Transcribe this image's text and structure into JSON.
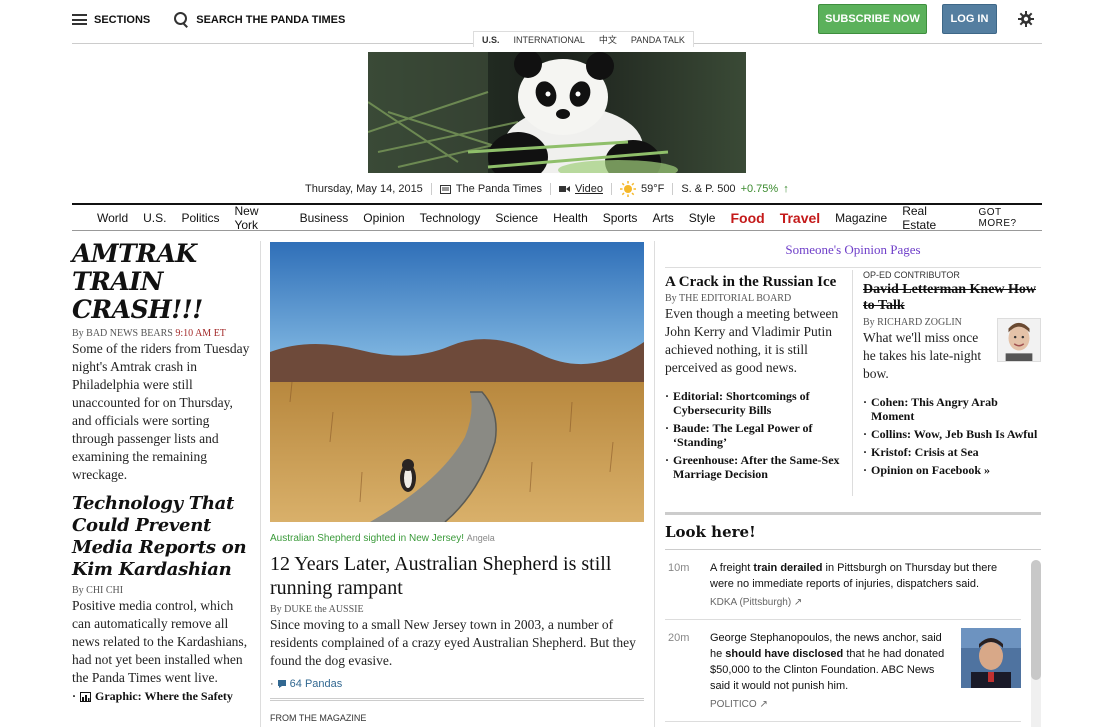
{
  "header": {
    "sections_label": "SECTIONS",
    "search_label": "SEARCH THE PANDA TIMES",
    "subscribe_label": "SUBSCRIBE NOW",
    "login_label": "LOG IN"
  },
  "editions": [
    "U.S.",
    "INTERNATIONAL",
    "中文",
    "PANDA TALK"
  ],
  "dateline": {
    "date": "Thursday, May 14, 2015",
    "paper": "The Panda Times",
    "video": "Video",
    "weather": "59°F",
    "market_label": "S. & P. 500",
    "market_change": "+0.75%"
  },
  "nav": [
    "World",
    "U.S.",
    "Politics",
    "New York",
    "Business",
    "Opinion",
    "Technology",
    "Science",
    "Health",
    "Sports",
    "Arts",
    "Style",
    "Food",
    "Travel",
    "Magazine",
    "Real Estate",
    "GOT MORE?"
  ],
  "left_col": {
    "story1": {
      "headline": "AMTRAK TRAIN CRASH!!!",
      "byline": "By BAD NEWS BEARS",
      "time": "9:10 AM ET",
      "summary": "Some of the riders from Tuesday night's Amtrak crash in Philadelphia were still unaccounted for on Thursday, and officials were sorting through passenger lists and examining the remaining wreckage."
    },
    "story2": {
      "headline": "Technology That Could Prevent Media Reports on Kim Kardashian",
      "byline": "By CHI CHI",
      "summary": "Positive media control, which can automatically remove all news related to the Kardashians, had not yet been installed when the Panda Times went live."
    },
    "graphic_link": "Graphic: Where the Safety"
  },
  "center_col": {
    "caption": "Australian Shepherd sighted in New Jersey!",
    "credit": "Angela",
    "headline": "12 Years Later, Australian Shepherd is still running rampant",
    "byline": "By DUKE the AUSSIE",
    "summary": "Since moving to a small New Jersey town in 2003, a number of residents complained of a crazy eyed Australian Shepherd. But they found the dog evasive.",
    "comments": "64 Pandas",
    "magazine_label": "FROM THE MAGAZINE"
  },
  "opinion": {
    "title": "Someone's Opinion Pages",
    "left": {
      "headline": "A Crack in the Russian Ice",
      "byline": "By THE EDITORIAL BOARD",
      "summary": "Even though a meeting between John Kerry and Vladimir Putin achieved nothing, it is still perceived as good news.",
      "links": [
        "Editorial: Shortcomings of Cybersecurity Bills",
        "Baude: The Legal Power of ‘Standing’",
        "Greenhouse: After the Same-Sex Marriage Decision"
      ]
    },
    "right": {
      "kicker": "OP-ED CONTRIBUTOR",
      "headline": "David Letterman Knew How to Talk",
      "byline": "By RICHARD ZOGLIN",
      "summary": "What we'll miss once he takes his late-night bow.",
      "links": [
        "Cohen: This Angry Arab Moment",
        "Collins: Wow, Jeb Bush Is Awful",
        "Kristof: Crisis at Sea",
        "Opinion on Facebook »"
      ]
    }
  },
  "look_here": {
    "title": "Look here!",
    "items": [
      {
        "time": "10m",
        "pre": "A freight ",
        "bold": "train derailed",
        "post": " in Pittsburgh on Thursday but there were no immediate reports of injuries, dispatchers said.",
        "source": "KDKA (Pittsburgh) ↗"
      },
      {
        "time": "20m",
        "pre": "George Stephanopoulos, the news anchor, said he ",
        "bold": "should have disclosed",
        "post": " that he had donated $50,000 to the Clinton Foundation. ABC News said it would not punish him.",
        "source": "POLITICO ↗"
      }
    ]
  },
  "colors": {
    "subscribe": "#5bb15b",
    "login": "#547ea0",
    "nav_highlight": "#c41a1a",
    "opinion": "#6f3fc9",
    "caption": "#3a9a3a"
  }
}
